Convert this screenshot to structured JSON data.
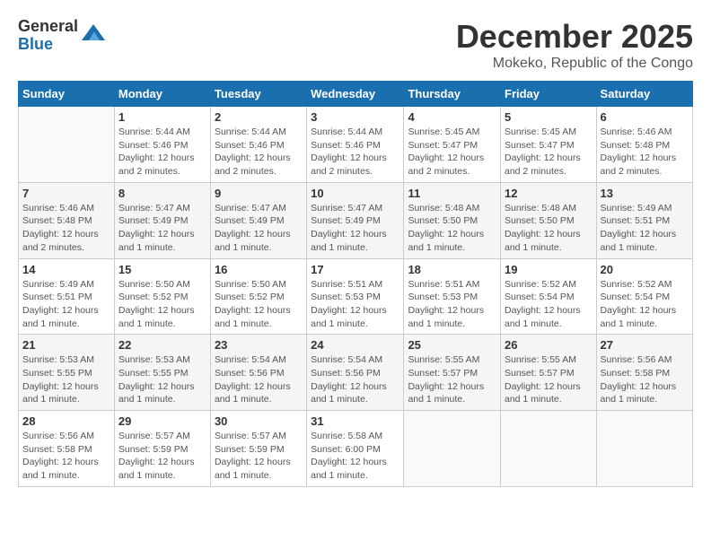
{
  "logo": {
    "general": "General",
    "blue": "Blue"
  },
  "title": {
    "month": "December 2025",
    "location": "Mokeko, Republic of the Congo"
  },
  "headers": [
    "Sunday",
    "Monday",
    "Tuesday",
    "Wednesday",
    "Thursday",
    "Friday",
    "Saturday"
  ],
  "weeks": [
    [
      {
        "day": "",
        "info": ""
      },
      {
        "day": "1",
        "info": "Sunrise: 5:44 AM\nSunset: 5:46 PM\nDaylight: 12 hours\nand 2 minutes."
      },
      {
        "day": "2",
        "info": "Sunrise: 5:44 AM\nSunset: 5:46 PM\nDaylight: 12 hours\nand 2 minutes."
      },
      {
        "day": "3",
        "info": "Sunrise: 5:44 AM\nSunset: 5:46 PM\nDaylight: 12 hours\nand 2 minutes."
      },
      {
        "day": "4",
        "info": "Sunrise: 5:45 AM\nSunset: 5:47 PM\nDaylight: 12 hours\nand 2 minutes."
      },
      {
        "day": "5",
        "info": "Sunrise: 5:45 AM\nSunset: 5:47 PM\nDaylight: 12 hours\nand 2 minutes."
      },
      {
        "day": "6",
        "info": "Sunrise: 5:46 AM\nSunset: 5:48 PM\nDaylight: 12 hours\nand 2 minutes."
      }
    ],
    [
      {
        "day": "7",
        "info": "Sunrise: 5:46 AM\nSunset: 5:48 PM\nDaylight: 12 hours\nand 2 minutes."
      },
      {
        "day": "8",
        "info": "Sunrise: 5:47 AM\nSunset: 5:49 PM\nDaylight: 12 hours\nand 1 minute."
      },
      {
        "day": "9",
        "info": "Sunrise: 5:47 AM\nSunset: 5:49 PM\nDaylight: 12 hours\nand 1 minute."
      },
      {
        "day": "10",
        "info": "Sunrise: 5:47 AM\nSunset: 5:49 PM\nDaylight: 12 hours\nand 1 minute."
      },
      {
        "day": "11",
        "info": "Sunrise: 5:48 AM\nSunset: 5:50 PM\nDaylight: 12 hours\nand 1 minute."
      },
      {
        "day": "12",
        "info": "Sunrise: 5:48 AM\nSunset: 5:50 PM\nDaylight: 12 hours\nand 1 minute."
      },
      {
        "day": "13",
        "info": "Sunrise: 5:49 AM\nSunset: 5:51 PM\nDaylight: 12 hours\nand 1 minute."
      }
    ],
    [
      {
        "day": "14",
        "info": "Sunrise: 5:49 AM\nSunset: 5:51 PM\nDaylight: 12 hours\nand 1 minute."
      },
      {
        "day": "15",
        "info": "Sunrise: 5:50 AM\nSunset: 5:52 PM\nDaylight: 12 hours\nand 1 minute."
      },
      {
        "day": "16",
        "info": "Sunrise: 5:50 AM\nSunset: 5:52 PM\nDaylight: 12 hours\nand 1 minute."
      },
      {
        "day": "17",
        "info": "Sunrise: 5:51 AM\nSunset: 5:53 PM\nDaylight: 12 hours\nand 1 minute."
      },
      {
        "day": "18",
        "info": "Sunrise: 5:51 AM\nSunset: 5:53 PM\nDaylight: 12 hours\nand 1 minute."
      },
      {
        "day": "19",
        "info": "Sunrise: 5:52 AM\nSunset: 5:54 PM\nDaylight: 12 hours\nand 1 minute."
      },
      {
        "day": "20",
        "info": "Sunrise: 5:52 AM\nSunset: 5:54 PM\nDaylight: 12 hours\nand 1 minute."
      }
    ],
    [
      {
        "day": "21",
        "info": "Sunrise: 5:53 AM\nSunset: 5:55 PM\nDaylight: 12 hours\nand 1 minute."
      },
      {
        "day": "22",
        "info": "Sunrise: 5:53 AM\nSunset: 5:55 PM\nDaylight: 12 hours\nand 1 minute."
      },
      {
        "day": "23",
        "info": "Sunrise: 5:54 AM\nSunset: 5:56 PM\nDaylight: 12 hours\nand 1 minute."
      },
      {
        "day": "24",
        "info": "Sunrise: 5:54 AM\nSunset: 5:56 PM\nDaylight: 12 hours\nand 1 minute."
      },
      {
        "day": "25",
        "info": "Sunrise: 5:55 AM\nSunset: 5:57 PM\nDaylight: 12 hours\nand 1 minute."
      },
      {
        "day": "26",
        "info": "Sunrise: 5:55 AM\nSunset: 5:57 PM\nDaylight: 12 hours\nand 1 minute."
      },
      {
        "day": "27",
        "info": "Sunrise: 5:56 AM\nSunset: 5:58 PM\nDaylight: 12 hours\nand 1 minute."
      }
    ],
    [
      {
        "day": "28",
        "info": "Sunrise: 5:56 AM\nSunset: 5:58 PM\nDaylight: 12 hours\nand 1 minute."
      },
      {
        "day": "29",
        "info": "Sunrise: 5:57 AM\nSunset: 5:59 PM\nDaylight: 12 hours\nand 1 minute."
      },
      {
        "day": "30",
        "info": "Sunrise: 5:57 AM\nSunset: 5:59 PM\nDaylight: 12 hours\nand 1 minute."
      },
      {
        "day": "31",
        "info": "Sunrise: 5:58 AM\nSunset: 6:00 PM\nDaylight: 12 hours\nand 1 minute."
      },
      {
        "day": "",
        "info": ""
      },
      {
        "day": "",
        "info": ""
      },
      {
        "day": "",
        "info": ""
      }
    ]
  ]
}
